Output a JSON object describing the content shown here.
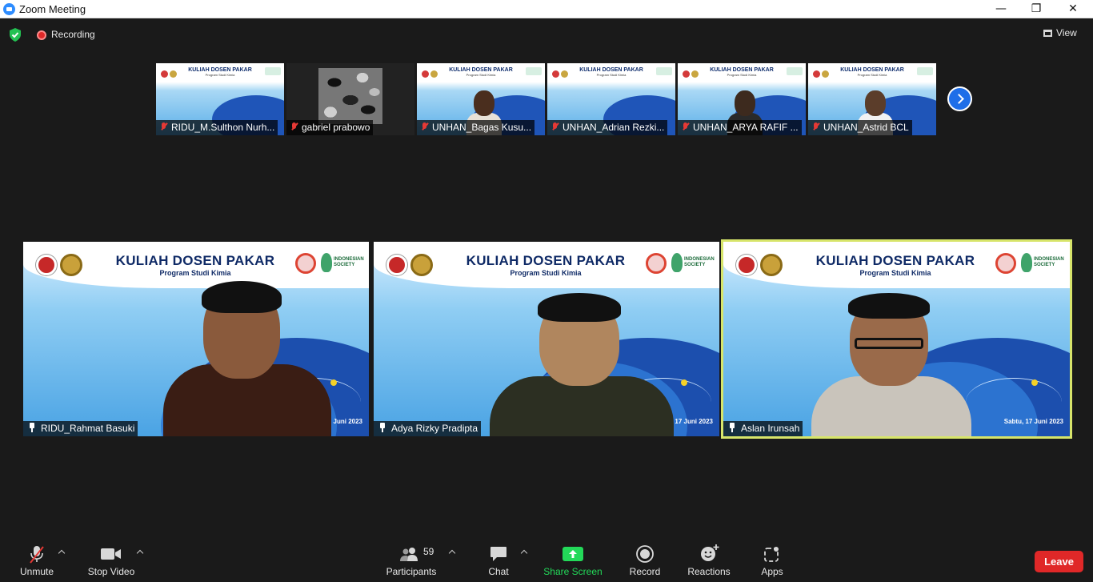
{
  "window": {
    "title": "Zoom Meeting",
    "controls": {
      "minimize": "—",
      "maximize": "❐",
      "close": "✕"
    }
  },
  "topbar": {
    "recording_label": "Recording",
    "view_label": "View"
  },
  "thumbnails": [
    {
      "name": "RIDU_M.Sulthon Nurh...",
      "muted": true,
      "video": "slide",
      "heading": "KULIAH DOSEN PAKAR",
      "subheading": "Program Studi Kimia"
    },
    {
      "name": "gabriel prabowo",
      "muted": true,
      "video": "camouflage"
    },
    {
      "name": "UNHAN_Bagas Kusu...",
      "muted": true,
      "video": "person",
      "heading": "KULIAH DOSEN PAKAR",
      "subheading": "Program Studi Kimia"
    },
    {
      "name": "UNHAN_Adrian Rezki...",
      "muted": true,
      "video": "slide",
      "heading": "KULIAH DOSEN PAKAR",
      "subheading": "Program Studi Kimia"
    },
    {
      "name": "UNHAN_ARYA RAFIF ...",
      "muted": true,
      "video": "person",
      "heading": "KULIAH DOSEN PAKAR",
      "subheading": "Program Studi Kimia"
    },
    {
      "name": "UNHAN_Astrid BCL",
      "muted": true,
      "video": "person",
      "heading": "KULIAH DOSEN PAKAR",
      "subheading": "Program Studi Kimia"
    }
  ],
  "main_tiles": [
    {
      "name": "RIDU_Rahmat Basuki",
      "pinned": true,
      "active": false,
      "heading": "KULIAH DOSEN PAKAR",
      "subheading": "Program Studi Kimia",
      "date": "Sabtu, 17 Juni 2023"
    },
    {
      "name": "Adya Rizky Pradipta",
      "pinned": true,
      "active": false,
      "heading": "KULIAH DOSEN PAKAR",
      "subheading": "Program Studi Kimia",
      "date": "Sabtu, 17 Juni 2023"
    },
    {
      "name": "Aslan Irunsah",
      "pinned": true,
      "active": true,
      "heading": "KULIAH DOSEN PAKAR",
      "subheading": "Program Studi Kimia",
      "date": "Sabtu, 17 Juni 2023"
    }
  ],
  "toolbar": {
    "unmute_label": "Unmute",
    "stop_video_label": "Stop Video",
    "participants_label": "Participants",
    "participants_count": "59",
    "chat_label": "Chat",
    "share_screen_label": "Share Screen",
    "record_label": "Record",
    "reactions_label": "Reactions",
    "apps_label": "Apps",
    "leave_label": "Leave"
  },
  "colors": {
    "background": "#1a1a1a",
    "active_speaker_border": "#d7e56a",
    "share_green": "#23d959",
    "leave_red": "#e02828",
    "mute_red": "#e53935",
    "accent_blue": "#1e6ee8"
  },
  "icons": {
    "security": "shield-check-icon",
    "recording": "record-dot-icon",
    "view": "grid-icon",
    "next": "chevron-right-icon",
    "muted": "mic-muted-icon",
    "pinned": "pin-icon"
  }
}
